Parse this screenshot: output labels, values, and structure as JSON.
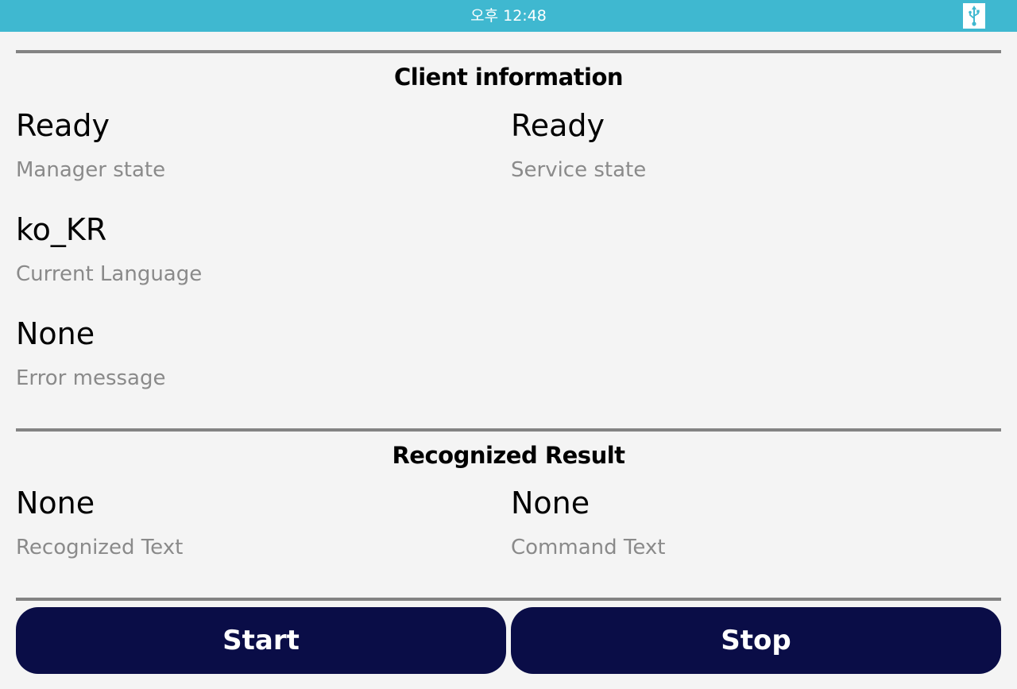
{
  "status_bar": {
    "time": "오후 12:48",
    "icon": "usb-icon",
    "color": "#3fb8d0"
  },
  "client_information": {
    "title": "Client information",
    "manager_state": {
      "value": "Ready",
      "label": "Manager state"
    },
    "service_state": {
      "value": "Ready",
      "label": "Service state"
    },
    "current_language": {
      "value": "ko_KR",
      "label": "Current Language"
    },
    "error_message": {
      "value": "None",
      "label": "Error message"
    }
  },
  "recognized_result": {
    "title": "Recognized Result",
    "recognized_text": {
      "value": "None",
      "label": "Recognized Text"
    },
    "command_text": {
      "value": "None",
      "label": "Command Text"
    }
  },
  "buttons": {
    "start_label": "Start",
    "stop_label": "Stop",
    "color": "#0a0d47"
  }
}
